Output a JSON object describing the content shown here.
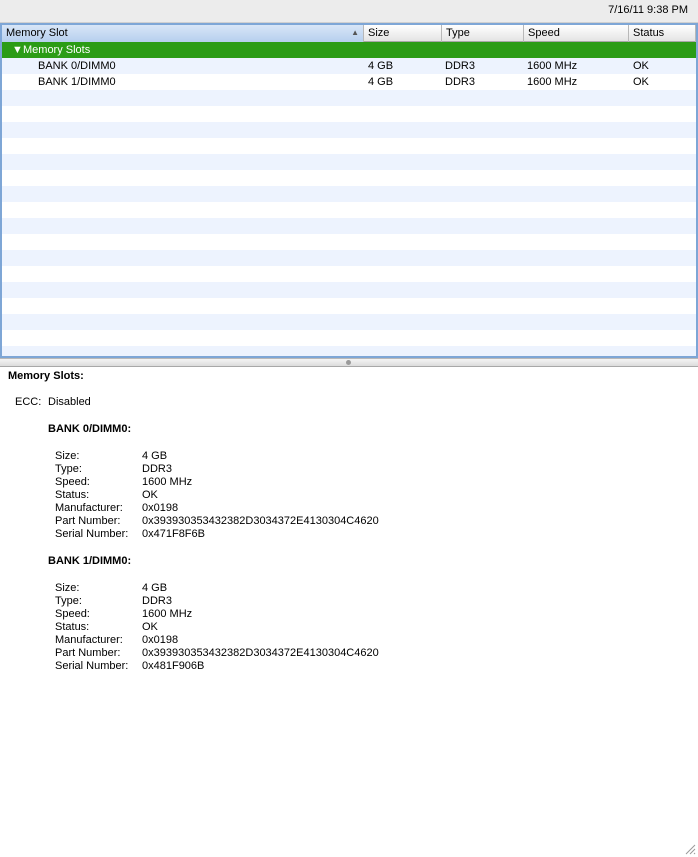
{
  "status_bar": {
    "datetime": "7/16/11 9:38 PM"
  },
  "table": {
    "columns": [
      "Memory Slot",
      "Size",
      "Type",
      "Speed",
      "Status"
    ],
    "sort_indicator": "▲",
    "group": {
      "toggle": "▼",
      "label": "Memory Slots"
    },
    "rows": [
      {
        "slot": "BANK 0/DIMM0",
        "size": "4 GB",
        "type": "DDR3",
        "speed": "1600 MHz",
        "status": "OK"
      },
      {
        "slot": "BANK 1/DIMM0",
        "size": "4 GB",
        "type": "DDR3",
        "speed": "1600 MHz",
        "status": "OK"
      }
    ]
  },
  "detail": {
    "heading": "Memory Slots:",
    "ecc_label": "ECC:",
    "ecc_value": "Disabled",
    "banks": [
      {
        "title": "BANK 0/DIMM0:",
        "fields": [
          {
            "label": "Size:",
            "value": "4 GB"
          },
          {
            "label": "Type:",
            "value": "DDR3"
          },
          {
            "label": "Speed:",
            "value": "1600 MHz"
          },
          {
            "label": "Status:",
            "value": "OK"
          },
          {
            "label": "Manufacturer:",
            "value": "0x0198"
          },
          {
            "label": "Part Number:",
            "value": "0x393930353432382D3034372E4130304C4620"
          },
          {
            "label": "Serial Number:",
            "value": "0x471F8F6B"
          }
        ]
      },
      {
        "title": "BANK 1/DIMM0:",
        "fields": [
          {
            "label": "Size:",
            "value": "4 GB"
          },
          {
            "label": "Type:",
            "value": "DDR3"
          },
          {
            "label": "Speed:",
            "value": "1600 MHz"
          },
          {
            "label": "Status:",
            "value": "OK"
          },
          {
            "label": "Manufacturer:",
            "value": "0x0198"
          },
          {
            "label": "Part Number:",
            "value": "0x393930353432382D3034372E4130304C4620"
          },
          {
            "label": "Serial Number:",
            "value": "0x481F906B"
          }
        ]
      }
    ]
  },
  "colors": {
    "group_row": "#2b9c16",
    "stripe": "#edf3fe",
    "frame": "#7ea6d6"
  }
}
